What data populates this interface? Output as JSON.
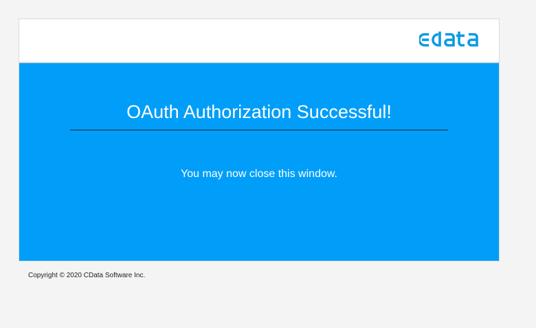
{
  "header": {
    "logo_text": "cdata",
    "logo_icon": "cdata-logo-icon",
    "brand_color": "#0a9be3"
  },
  "main": {
    "title": "OAuth Authorization Successful!",
    "message": "You may now close this window.",
    "background_color": "#009ef9"
  },
  "footer": {
    "copyright": "Copyright © 2020 CData Software Inc."
  }
}
